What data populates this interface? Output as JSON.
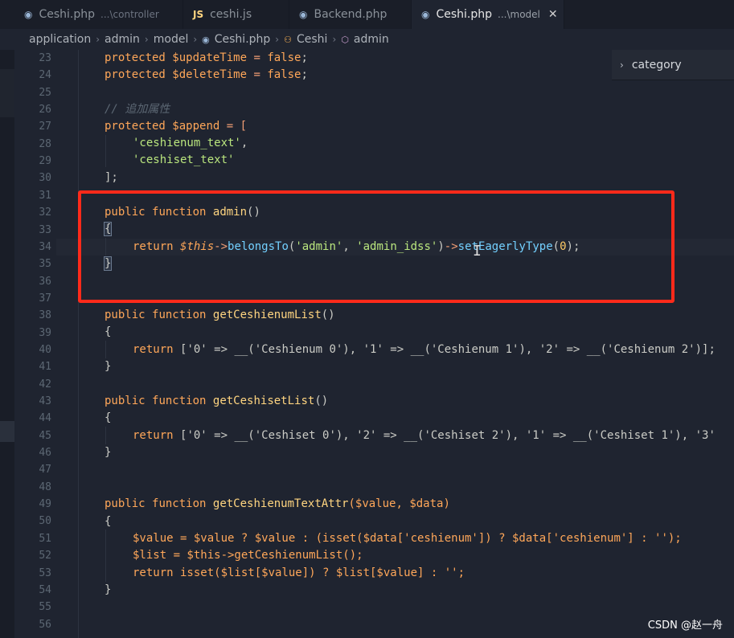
{
  "tabs": [
    {
      "label": "Ceshi.php",
      "path": "...\\controller",
      "icon": "php-icon",
      "active": false
    },
    {
      "label": "ceshi.js",
      "path": "",
      "icon": "js-icon",
      "active": false
    },
    {
      "label": "Backend.php",
      "path": "",
      "icon": "php-icon",
      "active": false
    },
    {
      "label": "Ceshi.php",
      "path": "...\\model",
      "icon": "php-icon",
      "active": true,
      "close": "✕"
    }
  ],
  "breadcrumb": {
    "items": [
      "application",
      "admin",
      "model",
      "Ceshi.php",
      "Ceshi",
      "admin"
    ],
    "separator": "›"
  },
  "sticky_scroll": {
    "label": "category",
    "chevron": "›"
  },
  "line_numbers": [
    "23",
    "24",
    "25",
    "26",
    "27",
    "28",
    "29",
    "30",
    "31",
    "32",
    "33",
    "34",
    "35",
    "36",
    "37",
    "38",
    "39",
    "40",
    "41",
    "42",
    "43",
    "44",
    "45",
    "46",
    "47",
    "48",
    "49",
    "50",
    "51",
    "52",
    "53",
    "54",
    "55",
    "56"
  ],
  "code": {
    "l23": {
      "kw": "protected",
      "var": "$updateTime",
      "rest": " = ",
      "val": "false",
      "end": ";"
    },
    "l24": {
      "kw": "protected",
      "var": "$deleteTime",
      "rest": " = ",
      "val": "false",
      "end": ";"
    },
    "l26": {
      "comment": "// 追加属性"
    },
    "l27": {
      "kw": "protected",
      "var": "$append",
      "rest": " = ["
    },
    "l28": {
      "str": "'ceshienum_text'",
      "end": ","
    },
    "l29": {
      "str": "'ceshiset_text'"
    },
    "l30": {
      "text": "];"
    },
    "l32": {
      "kw1": "public",
      "kw2": "function",
      "fn": "admin",
      "end": "()"
    },
    "l33": {
      "text": "{"
    },
    "l34": {
      "kw": "return",
      "this": "$this",
      "arrow": "->",
      "fn1": "belongsTo",
      "open": "(",
      "s1": "'admin'",
      "comma": ", ",
      "s2": "'admin_idss'",
      "close": ")",
      "arrow2": "->",
      "fn2": "setEagerlyType",
      "open2": "(",
      "num": "0",
      "close2": ");"
    },
    "l35": {
      "text": "}"
    },
    "l38": {
      "kw1": "public",
      "kw2": "function",
      "fn": "getCeshienumList",
      "end": "()"
    },
    "l39": {
      "text": "{"
    },
    "l40": {
      "kw": "return",
      "body": "['0' => __('Ceshienum 0'), '1' => __('Ceshienum 1'), '2' => __('Ceshienum 2')];"
    },
    "l41": {
      "text": "}"
    },
    "l43": {
      "kw1": "public",
      "kw2": "function",
      "fn": "getCeshisetList",
      "end": "()"
    },
    "l44": {
      "text": "{"
    },
    "l45": {
      "kw": "return",
      "body": "['0' => __('Ceshiset 0'), '2' => __('Ceshiset 2'), '1' => __('Ceshiset 1'), '3'"
    },
    "l46": {
      "text": "}"
    },
    "l49": {
      "kw1": "public",
      "kw2": "function",
      "fn": "getCeshienumTextAttr",
      "params": "($value, $data)"
    },
    "l50": {
      "text": "{"
    },
    "l51": {
      "text": "$value = $value ? $value : (isset($data['ceshienum']) ? $data['ceshienum'] : '');"
    },
    "l52": {
      "text": "$list = $this->getCeshienumList();"
    },
    "l53": {
      "text": "return isset($list[$value]) ? $list[$value] : '';"
    },
    "l54": {
      "text": "}"
    }
  },
  "watermark": "CSDN @赵一舟",
  "colors": {
    "annotation": "#ff2a1a",
    "background": "#1f2430",
    "keyword": "#ffa759",
    "string": "#bae67e",
    "function": "#ffd580"
  }
}
